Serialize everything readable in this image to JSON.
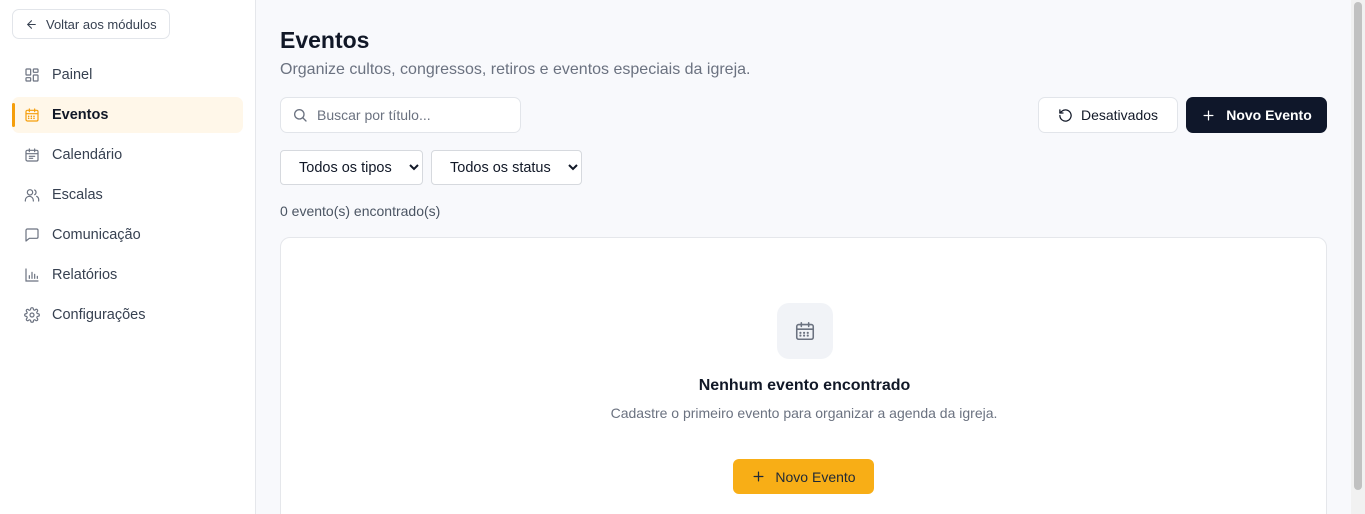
{
  "sidebar": {
    "back_label": "Voltar aos módulos",
    "items": [
      {
        "label": "Painel",
        "icon": "dashboard-icon",
        "active": false
      },
      {
        "label": "Eventos",
        "icon": "calendar-icon",
        "active": true
      },
      {
        "label": "Calendário",
        "icon": "calendar-days-icon",
        "active": false
      },
      {
        "label": "Escalas",
        "icon": "users-icon",
        "active": false
      },
      {
        "label": "Comunicação",
        "icon": "message-icon",
        "active": false
      },
      {
        "label": "Relatórios",
        "icon": "bar-chart-icon",
        "active": false
      },
      {
        "label": "Configurações",
        "icon": "gear-icon",
        "active": false
      }
    ]
  },
  "header": {
    "title": "Eventos",
    "subtitle": "Organize cultos, congressos, retiros e eventos especiais da igreja."
  },
  "toolbar": {
    "search_placeholder": "Buscar por título...",
    "search_value": "",
    "deactivated_label": "Desativados",
    "new_event_label": "Novo Evento"
  },
  "filters": {
    "type_selected": "Todos os tipos",
    "status_selected": "Todos os status"
  },
  "results": {
    "count_text": "0 evento(s) encontrado(s)"
  },
  "empty_state": {
    "title": "Nenhum evento encontrado",
    "text": "Cadastre o primeiro evento para organizar a agenda da igreja.",
    "button_label": "Novo Evento"
  },
  "colors": {
    "accent": "#f59e0b",
    "accent_bg": "#fff7e9",
    "primary_dark": "#0f172a",
    "empty_button": "#f8ae16"
  }
}
